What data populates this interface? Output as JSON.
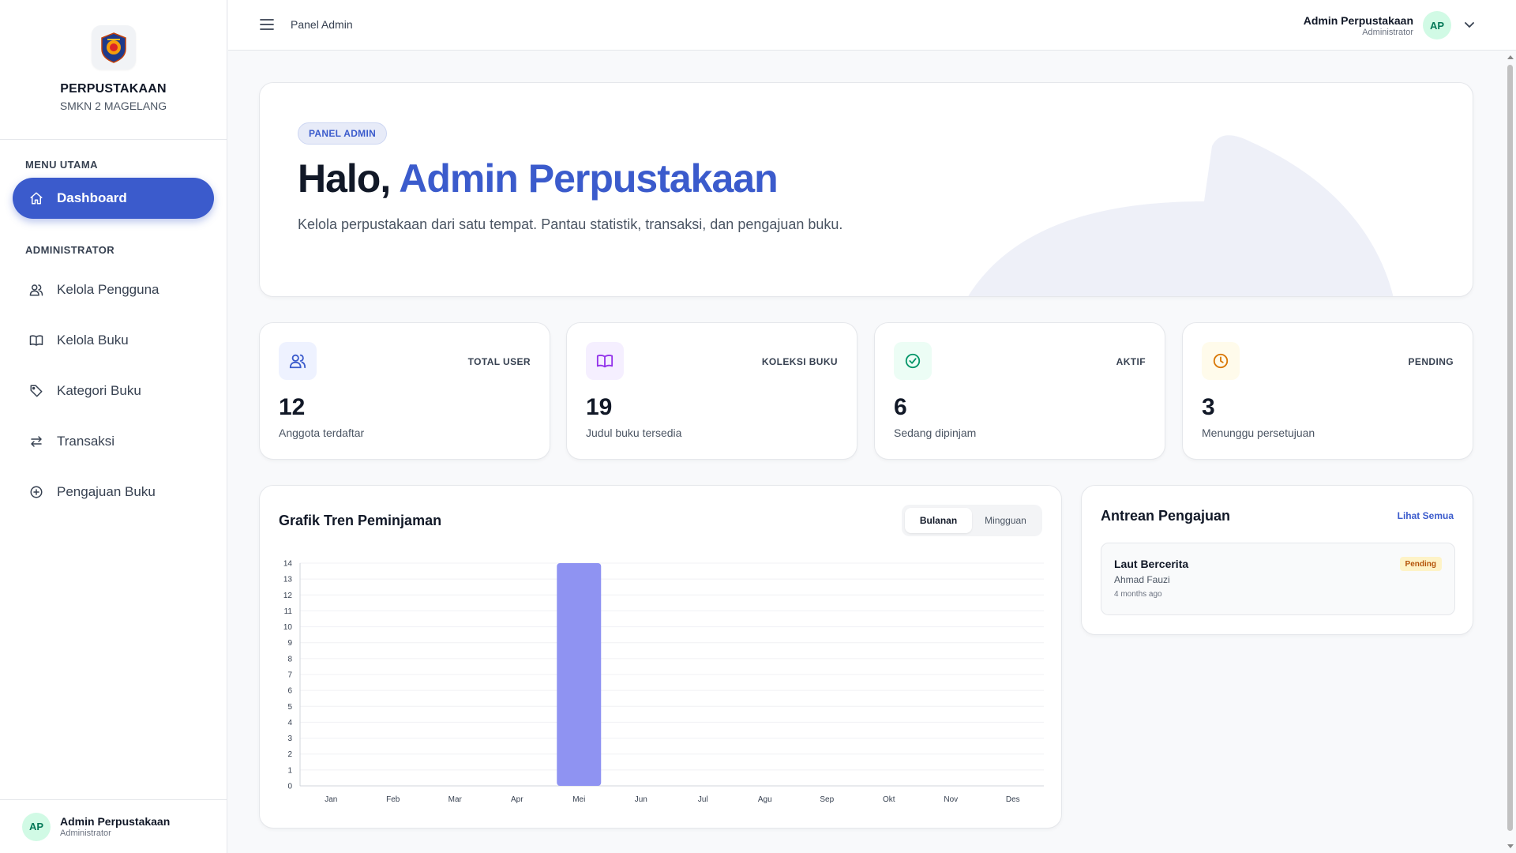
{
  "brand": {
    "name": "PERPUSTAKAAN",
    "sub": "SMKN 2 MAGELANG"
  },
  "sidebar": {
    "section_main": "MENU UTAMA",
    "section_admin": "ADMINISTRATOR",
    "items": [
      {
        "label": "Dashboard",
        "icon": "home-icon",
        "active": true
      },
      {
        "label": "Kelola Pengguna",
        "icon": "users-icon"
      },
      {
        "label": "Kelola Buku",
        "icon": "book-icon"
      },
      {
        "label": "Kategori Buku",
        "icon": "tag-icon"
      },
      {
        "label": "Transaksi",
        "icon": "swap-icon"
      },
      {
        "label": "Pengajuan Buku",
        "icon": "plus-circle-icon"
      }
    ],
    "user": {
      "initials": "AP",
      "name": "Admin Perpustakaan",
      "role": "Administrator"
    }
  },
  "topbar": {
    "breadcrumb": "Panel Admin",
    "user": {
      "initials": "AP",
      "name": "Admin Perpustakaan",
      "role": "Administrator"
    }
  },
  "hero": {
    "badge": "PANEL ADMIN",
    "greeting": "Halo, ",
    "name": "Admin Perpustakaan",
    "description": "Kelola perpustakaan dari satu tempat. Pantau statistik, transaksi, dan pengajuan buku."
  },
  "stats": [
    {
      "label": "TOTAL USER",
      "value": "12",
      "desc": "Anggota terdaftar",
      "icon": "users-icon",
      "color": "#3b5bcc",
      "bg": "#eef2ff"
    },
    {
      "label": "KOLEKSI BUKU",
      "value": "19",
      "desc": "Judul buku tersedia",
      "icon": "book-icon",
      "color": "#9333ea",
      "bg": "#f5efff"
    },
    {
      "label": "AKTIF",
      "value": "6",
      "desc": "Sedang dipinjam",
      "icon": "check-circle-icon",
      "color": "#059669",
      "bg": "#ecfdf5"
    },
    {
      "label": "PENDING",
      "value": "3",
      "desc": "Menunggu persetujuan",
      "icon": "clock-icon",
      "color": "#d97706",
      "bg": "#fffbeb"
    }
  ],
  "chart": {
    "title": "Grafik Tren Peminjaman",
    "toggle": [
      "Bulanan",
      "Mingguan"
    ],
    "active_toggle": "Bulanan"
  },
  "chart_data": {
    "type": "bar",
    "categories": [
      "Jan",
      "Feb",
      "Mar",
      "Apr",
      "Mei",
      "Jun",
      "Jul",
      "Agu",
      "Sep",
      "Okt",
      "Nov",
      "Des"
    ],
    "values": [
      0,
      0,
      0,
      0,
      14,
      0,
      0,
      0,
      0,
      0,
      0,
      0
    ],
    "ylim": [
      0,
      14
    ],
    "yticks": [
      0,
      1,
      2,
      3,
      4,
      5,
      6,
      7,
      8,
      9,
      10,
      11,
      12,
      13,
      14
    ],
    "bar_color": "#8f93f2",
    "grid": true
  },
  "queue": {
    "title": "Antrean Pengajuan",
    "link": "Lihat Semua",
    "items": [
      {
        "book": "Laut Bercerita",
        "name": "Ahmad Fauzi",
        "time": "4 months ago",
        "status": "Pending"
      }
    ]
  }
}
